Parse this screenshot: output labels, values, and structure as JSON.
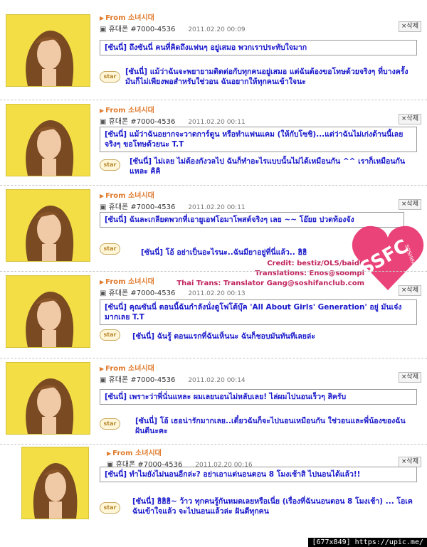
{
  "posts": [
    {
      "source": "From 소녀시대",
      "phone": "휴대폰 #7000-4536",
      "date": "2011.02.20 00:09",
      "delete_label": "×삭제",
      "message": "[ซันนี่] ถึงซันนี่ คนที่คิดถึงแฟนๆ อยู่เสมอ พวกเราประทับใจมาก",
      "reply": "[ซันนี่] แม้ว่าฉันจะพยายามติดต่อกับทุกคนอยู่เสมอ แต่ฉันต้องขอโทษด้วยจริงๆ ที่บางครั้งมันก็ไม่เพียงพอสำหรับใช่วอน ฉันอยากให้ทุกคนเข้าใจนะ"
    },
    {
      "source": "From 소녀시대",
      "phone": "휴대폰 #7000-4536",
      "date": "2011.02.20 00:11",
      "delete_label": "×삭제",
      "message": "[ซันนี่] แม้ว่าฉันอยากจะวาดการ์ตูน หรือทำแฟนแคม (ให้กับโซชิ)...แต่ว่าฉันไม่เก่งด้านนี้เลยจริงๆ ขอโทษด้วยนะ T.T",
      "reply": "[ซันนี่] ไม่เลย ไม่ต้องกังวลไป ฉันก็ทำอะไรแบบนั้นไม่ได้เหมือนกัน ^^ เราก็เหมือนกันแหละ คิคิ"
    },
    {
      "source": "From 소녀시대",
      "phone": "휴대폰 #7000-4536",
      "date": "2011.02.20 00:11",
      "delete_label": "×삭제",
      "message": "[ซันนี่] ฉันละเกลียดพวกที่เอายูเอฟโอมาโพสต์จริงๆ เลย ~~ โอ๊ยย ปวดท้องจัง",
      "reply": "[ซันนี่] โอ้ อย่าเป็นอะไรนะ..ฉันมียาอยู่ที่นี่แล้ว.. ฮิฮิ"
    },
    {
      "source": "From 소녀시대",
      "phone": "휴대폰 #7000-4536",
      "date": "2011.02.20 00:13",
      "delete_label": "×삭제",
      "message": "[ซันนี่] คุณซันนี่ ตอนนี้ฉันกำลังนั่งดูโฟโต้บุ๊ค 'All About Girls' Generation' อยู่ มันเจ๋งมากเลย T.T",
      "reply": "[ซันนี่] ฉันรู้ ตอนแรกที่ฉันเห็นนะ ฉันก็ชอบมันทันทีเลยล่ะ"
    },
    {
      "source": "From 소녀시대",
      "phone": "휴대폰 #7000-4536",
      "date": "2011.02.20 00:14",
      "delete_label": "×삭제",
      "message": "[ซันนี่] เพราะว่าพี่นั่นแหละ ผมเลยนอนไม่หลับเลย! ไล่ผมไปนอนเร็วๆ สิครับ",
      "reply": "[ซันนี่] โอ้ เธอน่ารักมากเลย..เดี๋ยวฉันก็จะไปนอนเหมือนกัน ใช่วอนและพี่น้องของฉัน ฝันดีนะคะ"
    },
    {
      "source": "From 소녀시대",
      "phone": "휴대폰 #7000-4536",
      "date": "2011.02.20 00:16",
      "delete_label": "×삭제",
      "message": "[ซันนี่] ทำไมยังไม่นอนอีกล่ะ? อย่าเอาแต่นอนตอน 8 โมงเช้าสิ ไปนอนได้แล้ว!!",
      "reply": "[ซันนี่] ฮิฮิฮิ~ ว้าว ทุกคนรู้กันหมดเลยหรือเนี่ย (เรื่องที่ฉันนอนตอน 8 โมงเช้า) ... โอเค ฉันเข้าใจแล้ว จะไปนอนแล้วล่ะ ฝันดีทุกคน"
    }
  ],
  "star_label": "star",
  "credits": {
    "line1": "Credit: bestiz/OLS/baidu",
    "line2": "Translations: Enos@soompi",
    "line3": "Thai Trans: Translator Gang@soshifanclub.com"
  },
  "logo": {
    "text": "SSFC",
    "subtext": "SOSHIFANCLUB",
    "color": "#e8336e"
  },
  "footer": "[677x849] https://upic.me/"
}
